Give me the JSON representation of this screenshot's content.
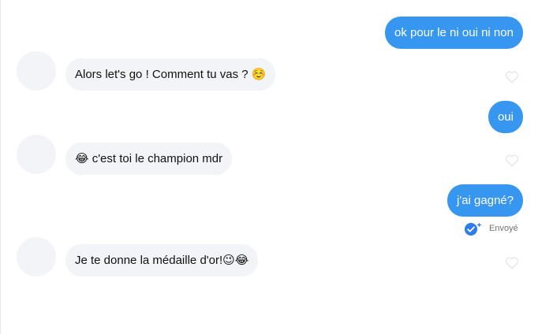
{
  "colors": {
    "outgoing_bubble": "#3797f0",
    "incoming_bubble": "#f2f4f8",
    "avatar_placeholder": "#f2f4f8",
    "status_icon": "#2b7de9"
  },
  "messages": [
    {
      "direction": "out",
      "text": "ok pour le ni oui ni non"
    },
    {
      "direction": "in",
      "text": "Alors let's go ! Comment tu vas ? ☺️"
    },
    {
      "direction": "out",
      "text": "oui"
    },
    {
      "direction": "in",
      "text": "😂 c'est toi le champion mdr"
    },
    {
      "direction": "out",
      "text": "j'ai gagné?"
    },
    {
      "direction": "in",
      "text": "Je te donne la médaille d'or!😉😂"
    }
  ],
  "status": {
    "label": "Envoyé",
    "icon": "sent-check-icon"
  },
  "icons": {
    "like": "heart-outline-icon",
    "avatar": "avatar-placeholder"
  }
}
